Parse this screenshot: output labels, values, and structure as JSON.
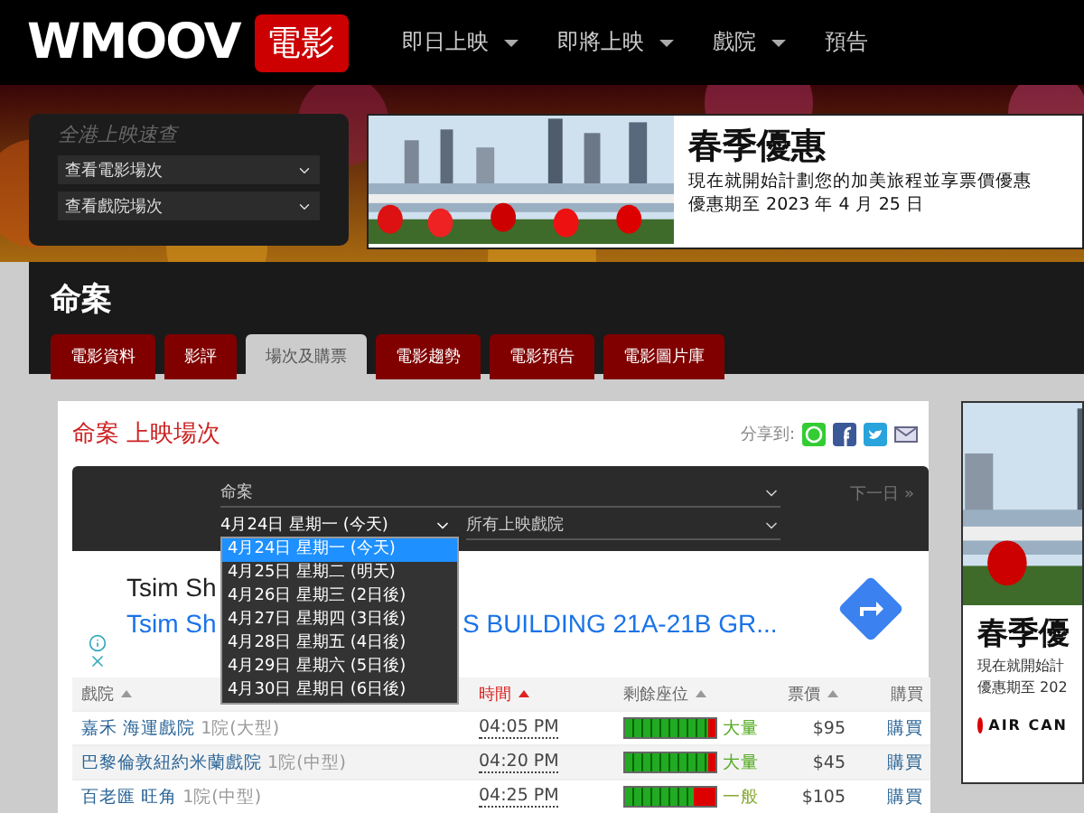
{
  "header": {
    "logo": "WMOOV",
    "logo_badge": "電影",
    "nav": [
      {
        "label": "即日上映",
        "has_menu": true
      },
      {
        "label": "即將上映",
        "has_menu": true
      },
      {
        "label": "戲院",
        "has_menu": true
      },
      {
        "label": "預告",
        "has_menu": false
      }
    ]
  },
  "quick_search": {
    "title": "全港上映速查",
    "selects": [
      "查看電影場次",
      "查看戲院場次"
    ]
  },
  "banner_ad": {
    "title": "春季優惠",
    "text": "現在就開始計劃您的加美旅程並享票價優惠",
    "note": "優惠期至 2023 年 4 月 25 日"
  },
  "movie": {
    "title": "命案",
    "tabs": [
      {
        "label": "電影資料",
        "selected": false
      },
      {
        "label": "影評",
        "selected": false
      },
      {
        "label": "場次及購票",
        "selected": true
      },
      {
        "label": "電影趨勢",
        "selected": false
      },
      {
        "label": "電影預告",
        "selected": false
      },
      {
        "label": "電影圖片庫",
        "selected": false
      }
    ]
  },
  "showtimes": {
    "title": "命案 上映場次",
    "share_label": "分享到:",
    "movie_select": "命案",
    "date_select": "4月24日 星期一 (今天)",
    "cinema_select": "所有上映戲院",
    "next_day": "下一日 »",
    "date_options": [
      {
        "label": "4月24日 星期一 (今天)",
        "selected": true
      },
      {
        "label": "4月25日 星期二 (明天)",
        "selected": false
      },
      {
        "label": "4月26日 星期三 (2日後)",
        "selected": false
      },
      {
        "label": "4月27日 星期四 (3日後)",
        "selected": false
      },
      {
        "label": "4月28日 星期五 (4日後)",
        "selected": false
      },
      {
        "label": "4月29日 星期六 (5日後)",
        "selected": false
      },
      {
        "label": "4月30日 星期日 (6日後)",
        "selected": false
      }
    ],
    "ad": {
      "line_1": "Tsim Sh",
      "line_2_start": "Tsim Sh",
      "line_2_end": "S BUILDING 21A-21B GR..."
    },
    "table": {
      "columns": [
        {
          "label": "戲院",
          "sortable": true,
          "sorted": false
        },
        {
          "label": "時間",
          "sortable": true,
          "sorted": true
        },
        {
          "label": "剩餘座位",
          "sortable": true,
          "sorted": false
        },
        {
          "label": "票價",
          "sortable": true,
          "sorted": false
        },
        {
          "label": "購買",
          "sortable": false,
          "sorted": false
        }
      ],
      "rows": [
        {
          "cinema": "嘉禾 海運戲院",
          "hall": "1院(大型)",
          "time": "04:05 PM",
          "level": 0.92,
          "seats": "大量",
          "price": "$95",
          "buy": "購買"
        },
        {
          "cinema": "巴黎倫敦紐約米蘭戲院",
          "hall": "1院(中型)",
          "time": "04:20 PM",
          "level": 0.92,
          "seats": "大量",
          "price": "$45",
          "buy": "購買"
        },
        {
          "cinema": "百老匯 旺角",
          "hall": "1院(中型)",
          "time": "04:25 PM",
          "level": 0.75,
          "seats": "一般",
          "price": "$105",
          "buy": "購買"
        }
      ]
    }
  },
  "side_ad": {
    "title": "春季優",
    "text": "現在就開始計",
    "note": "優惠期至 202",
    "brand": "AIR CAN"
  }
}
